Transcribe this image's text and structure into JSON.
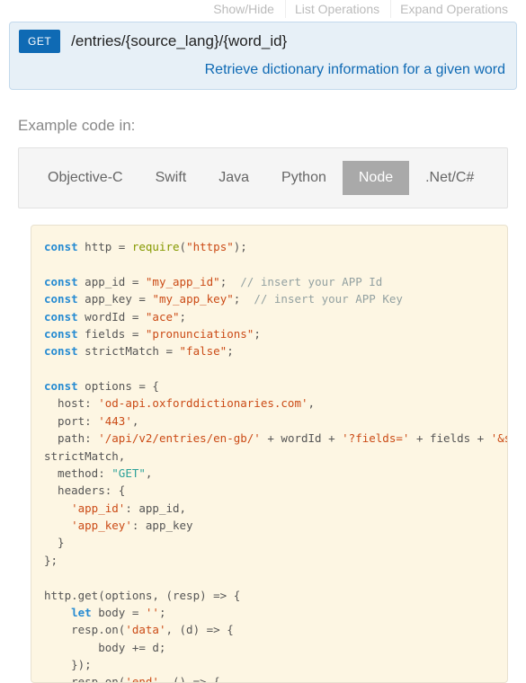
{
  "topLinks": {
    "showHide": "Show/Hide",
    "listOps": "List Operations",
    "expandOps": "Expand Operations"
  },
  "endpoint": {
    "method": "GET",
    "path": "/entries/{source_lang}/{word_id}",
    "description": "Retrieve dictionary information for a given word"
  },
  "exampleLabel": "Example code in:",
  "tabs": {
    "objc": "Objective-C",
    "swift": "Swift",
    "java": "Java",
    "python": "Python",
    "node": "Node",
    "dotnet": ".Net/C#"
  },
  "code": {
    "kw_const": "const",
    "http": " http = ",
    "require": "require",
    "lp": "(",
    "https_str": "\"https\"",
    "rp_semi": ");",
    "appid_decl": " app_id = ",
    "appid_val": "\"my_app_id\"",
    "semi": ";",
    "com_appid": "  // insert your APP Id",
    "appkey_decl": " app_key = ",
    "appkey_val": "\"my_app_key\"",
    "com_appkey": "  // insert your APP Key",
    "wordid_decl": " wordId = ",
    "wordid_val": "\"ace\"",
    "fields_decl": " fields = ",
    "fields_val": "\"pronunciations\"",
    "strict_decl": " strictMatch = ",
    "strict_val": "\"false\"",
    "options_decl": " options = {",
    "host_lbl": "  host: ",
    "host_val": "'od-api.oxforddictionaries.com'",
    "comma": ",",
    "port_lbl": "  port: ",
    "port_val": "'443'",
    "path_lbl": "  path: ",
    "path_val": "'/api/v2/entries/en-gb/'",
    "plus_word": " + wordId + ",
    "qfields": "'?fields='",
    "plus_fields": " + fields + ",
    "qstrict": "'&strictMatch='",
    "plus_strict": " + ",
    "strict_tail": "strictMatch,",
    "method_lbl": "  method: ",
    "method_val": "\"GET\"",
    "headers_lbl": "  headers: {",
    "hdr_appid_key": "'app_id'",
    "hdr_appid_v": ": app_id,",
    "hdr_appkey_key": "'app_key'",
    "hdr_appkey_v": ": app_key",
    "close_brace": "  }",
    "close_obj": "};",
    "httpget": "http.get(options, (resp) => {",
    "let": "let",
    "body_decl": " body = ",
    "body_val": "''",
    "respon1": "    resp.on(",
    "data_ev": "'data'",
    "arrow_d": ", (d) => {",
    "body_plus": "        body += d;",
    "cb_close": "    });",
    "respon2": "    resp.on(",
    "end_ev": "'end'",
    "arrow_e": ", () => {"
  }
}
